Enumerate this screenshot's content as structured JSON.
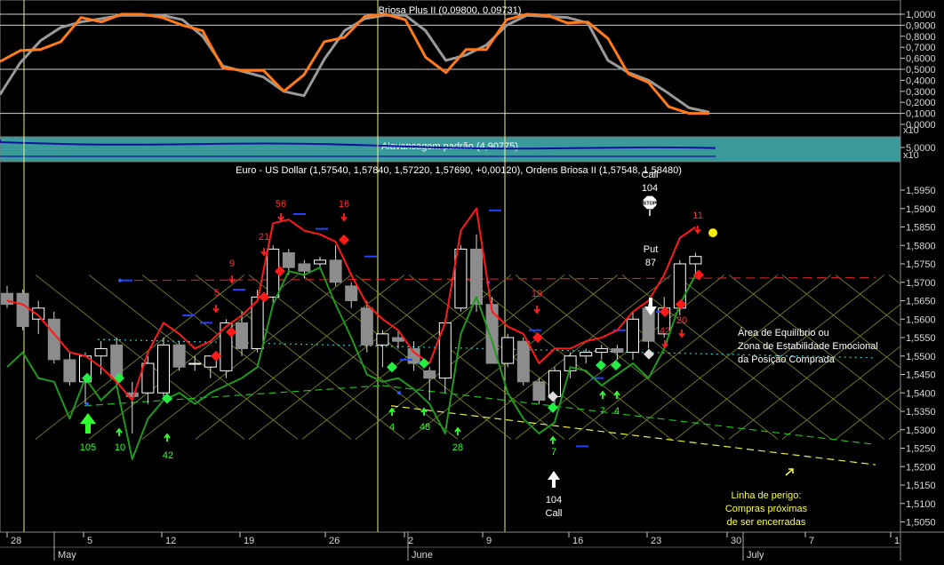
{
  "panels": {
    "osc_title": "Briosa Plus II (0,09800, 0,09731)",
    "lev_title": "Alavancagem padrão (4,90775)",
    "price_title": "Euro - US Dollar (1,57540, 1,57840, 1,57220, 1,57690, +0,00120), Ordens Briosa II (1,57548, 1,58480)",
    "x10_a": "x10",
    "x10_b": "x10"
  },
  "osc_axis": [
    "1,0000",
    "0,9000",
    "0,8000",
    "0,7000",
    "0,6000",
    "0,5000",
    "0,4000",
    "0,3000",
    "0,2000",
    "0,1000",
    "0,0000"
  ],
  "lev_axis": [
    "5,0000"
  ],
  "price_axis": [
    "1,5950",
    "1,5900",
    "1,5850",
    "1,5800",
    "1,5750",
    "1,5700",
    "1,5650",
    "1,5600",
    "1,5550",
    "1,5500",
    "1,5450",
    "1,5400",
    "1,5350",
    "1,5300",
    "1,5250",
    "1,5200",
    "1,5150",
    "1,5100",
    "1,5050"
  ],
  "time_axis": {
    "days": [
      "28",
      "5",
      "12",
      "19",
      "26",
      "2",
      "9",
      "16",
      "23",
      "30",
      "7",
      "1"
    ],
    "months": [
      "May",
      "June",
      "July"
    ]
  },
  "annotations": {
    "red_counts": [
      "56",
      "16",
      "21",
      "9",
      "5",
      "19",
      "42",
      "20",
      "11"
    ],
    "green_counts": [
      "105",
      "10",
      "42",
      "4",
      "48",
      "28",
      "7",
      "7",
      "4"
    ],
    "put_label": "Put",
    "put_count": "87",
    "call_top_label": "Call",
    "call_top_count": "104",
    "stop_text": "STOP",
    "call_bottom_count": "104",
    "call_bottom_label": "Call",
    "equilibrium_text": [
      "Área de Equilíbrio ou",
      "Zona de Estabilidade Emocional",
      "da Posição Comprada"
    ],
    "danger_text": [
      "Linha de perigo:",
      "Compras próximas",
      "de ser encerradas"
    ]
  },
  "colors": {
    "orange": "#ff7a1a",
    "gray": "#9a9a9a",
    "teal": "#3aa8a8",
    "red": "#ff2020",
    "green": "#22bb22",
    "yellow": "#ffff66",
    "bright_green": "#22ff44"
  },
  "chart_data": {
    "type": "candlestick",
    "title": "Euro - US Dollar (1,57540, 1,57840, 1,57220, 1,57690, +0,00120), Ordens Briosa II (1,57548, 1,58480)",
    "ylim": [
      1.503,
      1.599
    ],
    "candles": [
      {
        "o": 1.567,
        "h": 1.569,
        "l": 1.563,
        "c": 1.564
      },
      {
        "o": 1.567,
        "h": 1.568,
        "l": 1.557,
        "c": 1.558
      },
      {
        "o": 1.56,
        "h": 1.565,
        "l": 1.556,
        "c": 1.563
      },
      {
        "o": 1.56,
        "h": 1.562,
        "l": 1.548,
        "c": 1.549
      },
      {
        "o": 1.549,
        "h": 1.551,
        "l": 1.542,
        "c": 1.543
      },
      {
        "o": 1.543,
        "h": 1.551,
        "l": 1.537,
        "c": 1.55
      },
      {
        "o": 1.55,
        "h": 1.554,
        "l": 1.545,
        "c": 1.552
      },
      {
        "o": 1.553,
        "h": 1.555,
        "l": 1.542,
        "c": 1.544
      },
      {
        "o": 1.54,
        "h": 1.543,
        "l": 1.529,
        "c": 1.539
      },
      {
        "o": 1.54,
        "h": 1.55,
        "l": 1.537,
        "c": 1.548
      },
      {
        "o": 1.54,
        "h": 1.555,
        "l": 1.538,
        "c": 1.553
      },
      {
        "o": 1.553,
        "h": 1.554,
        "l": 1.546,
        "c": 1.547
      },
      {
        "o": 1.548,
        "h": 1.55,
        "l": 1.546,
        "c": 1.548
      },
      {
        "o": 1.547,
        "h": 1.55,
        "l": 1.544,
        "c": 1.55
      },
      {
        "o": 1.546,
        "h": 1.56,
        "l": 1.544,
        "c": 1.559
      },
      {
        "o": 1.559,
        "h": 1.562,
        "l": 1.55,
        "c": 1.552
      },
      {
        "o": 1.552,
        "h": 1.568,
        "l": 1.551,
        "c": 1.566
      },
      {
        "o": 1.566,
        "h": 1.58,
        "l": 1.564,
        "c": 1.579
      },
      {
        "o": 1.578,
        "h": 1.579,
        "l": 1.572,
        "c": 1.574
      },
      {
        "o": 1.575,
        "h": 1.576,
        "l": 1.571,
        "c": 1.573
      },
      {
        "o": 1.575,
        "h": 1.577,
        "l": 1.574,
        "c": 1.576
      },
      {
        "o": 1.576,
        "h": 1.58,
        "l": 1.569,
        "c": 1.57
      },
      {
        "o": 1.569,
        "h": 1.57,
        "l": 1.563,
        "c": 1.565
      },
      {
        "o": 1.563,
        "h": 1.565,
        "l": 1.551,
        "c": 1.553
      },
      {
        "o": 1.553,
        "h": 1.557,
        "l": 1.547,
        "c": 1.556
      },
      {
        "o": 1.555,
        "h": 1.557,
        "l": 1.552,
        "c": 1.554
      },
      {
        "o": 1.552,
        "h": 1.554,
        "l": 1.546,
        "c": 1.548
      },
      {
        "o": 1.546,
        "h": 1.547,
        "l": 1.538,
        "c": 1.544
      },
      {
        "o": 1.544,
        "h": 1.56,
        "l": 1.54,
        "c": 1.559
      },
      {
        "o": 1.563,
        "h": 1.58,
        "l": 1.562,
        "c": 1.579
      },
      {
        "o": 1.579,
        "h": 1.583,
        "l": 1.562,
        "c": 1.564
      },
      {
        "o": 1.564,
        "h": 1.566,
        "l": 1.548,
        "c": 1.548
      },
      {
        "o": 1.548,
        "h": 1.556,
        "l": 1.547,
        "c": 1.555
      },
      {
        "o": 1.554,
        "h": 1.555,
        "l": 1.542,
        "c": 1.543
      },
      {
        "o": 1.543,
        "h": 1.544,
        "l": 1.537,
        "c": 1.538
      },
      {
        "o": 1.539,
        "h": 1.547,
        "l": 1.537,
        "c": 1.546
      },
      {
        "o": 1.546,
        "h": 1.551,
        "l": 1.544,
        "c": 1.55
      },
      {
        "o": 1.55,
        "h": 1.552,
        "l": 1.548,
        "c": 1.551
      },
      {
        "o": 1.551,
        "h": 1.553,
        "l": 1.549,
        "c": 1.552
      },
      {
        "o": 1.552,
        "h": 1.553,
        "l": 1.549,
        "c": 1.551
      },
      {
        "o": 1.551,
        "h": 1.562,
        "l": 1.549,
        "c": 1.56
      },
      {
        "o": 1.563,
        "h": 1.564,
        "l": 1.552,
        "c": 1.554
      },
      {
        "o": 1.556,
        "h": 1.566,
        "l": 1.555,
        "c": 1.563
      },
      {
        "o": 1.563,
        "h": 1.576,
        "l": 1.561,
        "c": 1.575
      },
      {
        "o": 1.575,
        "h": 1.578,
        "l": 1.572,
        "c": 1.577
      }
    ],
    "red_line": [
      1.565,
      1.564,
      1.561,
      1.556,
      1.551,
      1.55,
      1.547,
      1.543,
      1.538,
      1.551,
      1.559,
      1.556,
      1.552,
      1.554,
      1.558,
      1.561,
      1.565,
      1.586,
      1.587,
      1.584,
      1.583,
      1.581,
      1.572,
      1.564,
      1.56,
      1.557,
      1.551,
      1.548,
      1.559,
      1.584,
      1.59,
      1.562,
      1.558,
      1.556,
      1.548,
      1.552,
      1.552,
      1.554,
      1.555,
      1.557,
      1.562,
      1.565,
      1.572,
      1.582,
      1.585
    ],
    "green_line": [
      1.547,
      1.551,
      1.544,
      1.543,
      1.533,
      1.544,
      1.538,
      1.542,
      1.522,
      1.533,
      1.538,
      1.54,
      1.537,
      1.54,
      1.542,
      1.544,
      1.547,
      1.564,
      1.573,
      1.572,
      1.574,
      1.564,
      1.555,
      1.545,
      1.543,
      1.544,
      1.541,
      1.537,
      1.529,
      1.556,
      1.566,
      1.554,
      1.54,
      1.533,
      1.529,
      1.532,
      1.547,
      1.546,
      1.542,
      1.545,
      1.548,
      1.544,
      1.552,
      1.564,
      1.572
    ]
  },
  "osc_data": {
    "orange": [
      0.57,
      0.67,
      0.68,
      0.75,
      0.97,
      0.93,
      1.0,
      1.0,
      0.97,
      0.9,
      0.85,
      0.51,
      0.49,
      0.49,
      0.3,
      0.45,
      0.75,
      0.79,
      0.98,
      1.0,
      0.95,
      0.61,
      0.47,
      0.68,
      0.68,
      0.95,
      1.0,
      0.99,
      0.92,
      0.93,
      0.78,
      0.46,
      0.38,
      0.16,
      0.1,
      0.1
    ],
    "gray": [
      0.27,
      0.56,
      0.76,
      0.88,
      0.93,
      0.96,
      0.99,
      0.99,
      0.99,
      0.95,
      0.8,
      0.53,
      0.48,
      0.43,
      0.3,
      0.26,
      0.59,
      0.85,
      0.96,
      0.99,
      0.99,
      0.85,
      0.58,
      0.63,
      0.72,
      0.9,
      0.99,
      0.98,
      0.97,
      0.92,
      0.58,
      0.47,
      0.4,
      0.28,
      0.15,
      0.11
    ],
    "ylim": [
      0.0,
      1.04
    ]
  }
}
